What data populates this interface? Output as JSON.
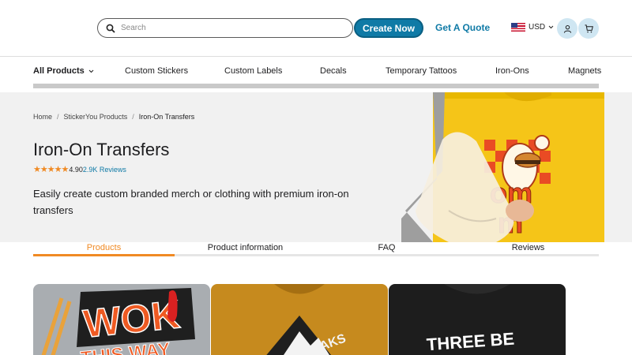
{
  "header": {
    "search_placeholder": "Search",
    "create_label": "Create Now",
    "quote_label": "Get A Quote",
    "currency": "USD"
  },
  "nav": {
    "items": [
      {
        "label": "All Products"
      },
      {
        "label": "Custom Stickers"
      },
      {
        "label": "Custom Labels"
      },
      {
        "label": "Decals"
      },
      {
        "label": "Temporary Tattoos"
      },
      {
        "label": "Iron-Ons"
      },
      {
        "label": "Magnets"
      }
    ]
  },
  "breadcrumb": [
    "Home",
    "StickerYou Products",
    "Iron-On Transfers"
  ],
  "hero": {
    "title": "Iron-On Transfers",
    "rating_value": "4.90",
    "review_count": "2.9K Reviews",
    "description": "Easily create custom branded merch or clothing with premium iron-on transfers"
  },
  "hero_art_text": [
    "om",
    "m"
  ],
  "tabs": [
    {
      "label": "Products"
    },
    {
      "label": "Product information"
    },
    {
      "label": "FAQ"
    },
    {
      "label": "Reviews"
    }
  ],
  "cards": [
    {
      "art_text": [
        "WOK",
        "THIS WAY"
      ],
      "colors": {
        "bg": "#a9adb1",
        "fg": "#ef5a22"
      }
    },
    {
      "art_text": [
        "EAKS"
      ],
      "colors": {
        "bg": "#c68a1e",
        "fg": "#1f1f1f"
      }
    },
    {
      "art_text": [
        "THREE BE"
      ],
      "colors": {
        "bg": "#1d1d1d",
        "fg": "#ffffff"
      }
    }
  ],
  "colors": {
    "accent": "#0f7aa6",
    "orange": "#f08a24",
    "hero_bg": "#f1f1f1"
  }
}
